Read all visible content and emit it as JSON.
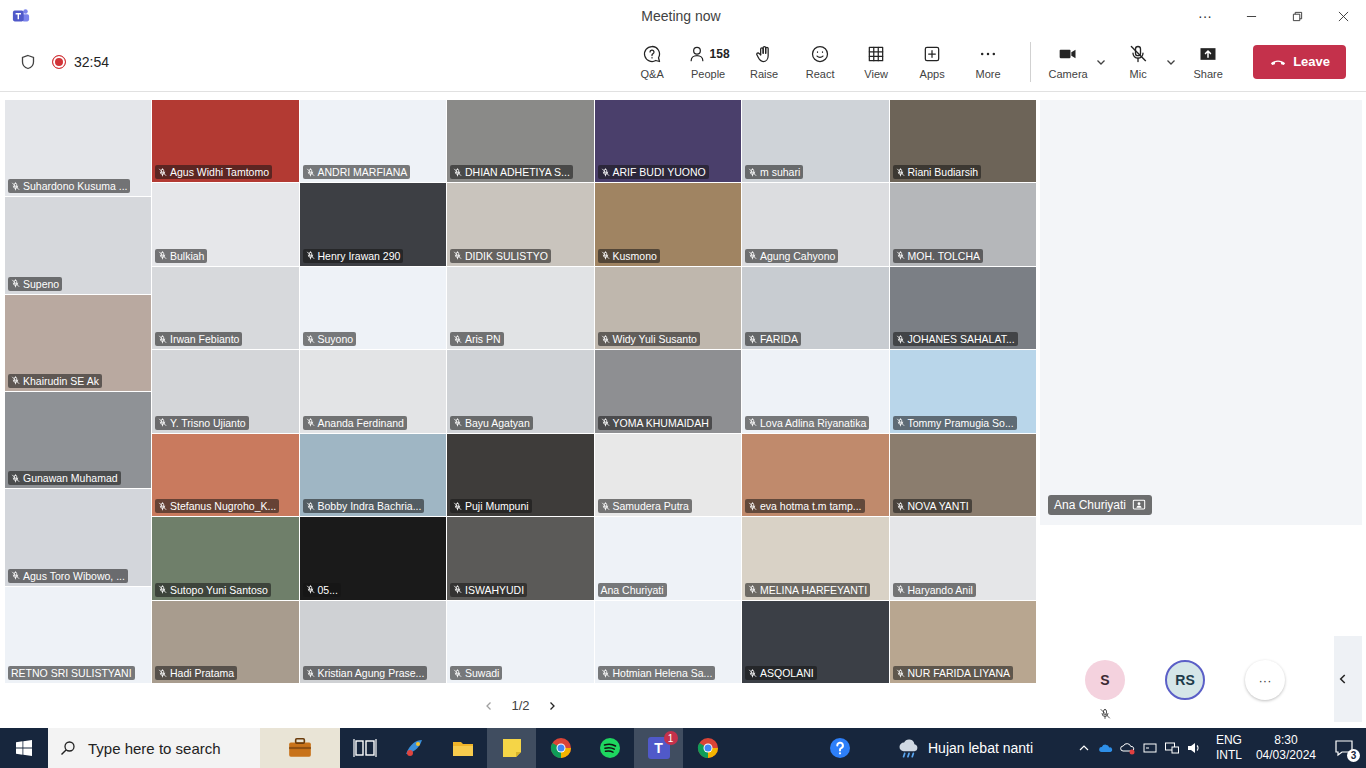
{
  "window": {
    "title": "Meeting now",
    "more": "···"
  },
  "toolbar": {
    "recording": true,
    "timer": "32:54",
    "tools": [
      {
        "label": "Q&A"
      },
      {
        "label": "People",
        "count": "158"
      },
      {
        "label": "Raise"
      },
      {
        "label": "React"
      },
      {
        "label": "View"
      },
      {
        "label": "Apps"
      },
      {
        "label": "More"
      }
    ],
    "devices": [
      {
        "label": "Camera",
        "off": false,
        "menu": true
      },
      {
        "label": "Mic",
        "off": true,
        "menu": true
      },
      {
        "label": "Share",
        "off": false,
        "menu": false
      }
    ],
    "leave": "Leave"
  },
  "gallery": {
    "left_column": [
      {
        "name": "Suhardono Kusuma ...",
        "muted": true,
        "color": "#e4e6ea"
      },
      {
        "name": "Supeno",
        "muted": true,
        "color": "#d6d8dc"
      },
      {
        "name": "Khairudin SE Ak",
        "muted": true,
        "color": "#b9a9a0"
      },
      {
        "name": "Gunawan Muhamad",
        "muted": true,
        "color": "#8f9296"
      },
      {
        "name": "Agus Toro Wibowo, ...",
        "muted": true,
        "color": "#d3d6db"
      },
      {
        "name": "RETNO SRI SULISTYANI",
        "muted": false,
        "color": "#eef2f7"
      }
    ],
    "tiles": [
      {
        "name": "Agus Widhi Tamtomo",
        "muted": true,
        "color": "#b33a33"
      },
      {
        "name": "ANDRI MARFIANA",
        "muted": true,
        "color": "#eef2f7"
      },
      {
        "name": "DHIAN ADHETIYA S...",
        "muted": true,
        "color": "#8a8a88"
      },
      {
        "name": "ARIF BUDI YUONO",
        "muted": true,
        "color": "#4a3f6b"
      },
      {
        "name": "m suhari",
        "muted": true,
        "color": "#cfd3d8"
      },
      {
        "name": "Riani Budiarsih",
        "muted": true,
        "color": "#6d6458"
      },
      {
        "name": "Bulkiah",
        "muted": true,
        "color": "#e6e7ea"
      },
      {
        "name": "Henry Irawan 290",
        "muted": true,
        "color": "#3d3f44"
      },
      {
        "name": "DIDIK SULISTYO",
        "muted": true,
        "color": "#c9c4bd"
      },
      {
        "name": "Kusmono",
        "muted": true,
        "color": "#a08462"
      },
      {
        "name": "Agung Cahyono",
        "muted": true,
        "color": "#dcdde0"
      },
      {
        "name": "MOH. TOLCHA",
        "muted": true,
        "color": "#b5b7ba"
      },
      {
        "name": "Irwan Febianto",
        "muted": true,
        "color": "#d7d9dc"
      },
      {
        "name": "Suyono",
        "muted": true,
        "color": "#eef2f7"
      },
      {
        "name": "Aris PN",
        "muted": true,
        "color": "#e1e3e5"
      },
      {
        "name": "Widy Yuli Susanto",
        "muted": true,
        "color": "#bfb7ad"
      },
      {
        "name": "FARIDA",
        "muted": true,
        "color": "#c8ccd1"
      },
      {
        "name": "JOHANES SAHALAT...",
        "muted": true,
        "color": "#7b7f85"
      },
      {
        "name": "Y. Trisno Ujianto",
        "muted": true,
        "color": "#d4d6d9"
      },
      {
        "name": "Ananda Ferdinand",
        "muted": true,
        "color": "#e3e4e6"
      },
      {
        "name": "Bayu Agatyan",
        "muted": true,
        "color": "#cfd2d6"
      },
      {
        "name": "YOMA KHUMAIDAH",
        "muted": true,
        "color": "#8e8f92"
      },
      {
        "name": "Lova Adlina Riyanatika",
        "muted": true,
        "color": "#eef2f7"
      },
      {
        "name": "Tommy Pramugia So...",
        "muted": true,
        "color": "#b9d6ea"
      },
      {
        "name": "Stefanus Nugroho_K...",
        "muted": true,
        "color": "#c97a5e"
      },
      {
        "name": "Bobby Indra Bachria...",
        "muted": true,
        "color": "#9fb6c4"
      },
      {
        "name": "Puji Mumpuni",
        "muted": true,
        "color": "#3e3c3a"
      },
      {
        "name": "Samudera Putra",
        "muted": true,
        "color": "#e8e8e8"
      },
      {
        "name": "eva hotma t.m tamp...",
        "muted": true,
        "color": "#c08a6c"
      },
      {
        "name": "NOVA YANTI",
        "muted": true,
        "color": "#8b7d6e"
      },
      {
        "name": "Sutopo Yuni Santoso",
        "muted": true,
        "color": "#6f7f6a"
      },
      {
        "name": "05...",
        "muted": true,
        "color": "#1a1a1a"
      },
      {
        "name": "ISWAHYUDI",
        "muted": true,
        "color": "#5b5a58"
      },
      {
        "name": "Ana Churiyati",
        "muted": false,
        "color": "#eef2f7"
      },
      {
        "name": "MELINA HARFEYANTI",
        "muted": true,
        "color": "#d9d2c6"
      },
      {
        "name": "Haryando Anil",
        "muted": true,
        "color": "#e5e6e8"
      },
      {
        "name": "Hadi Pratama",
        "muted": true,
        "color": "#a89c8e"
      },
      {
        "name": "Kristian Agung Prase...",
        "muted": true,
        "color": "#cfd1d4"
      },
      {
        "name": "Suwadi",
        "muted": true,
        "color": "#eef2f7"
      },
      {
        "name": "Hotmian Helena Sa...",
        "muted": true,
        "color": "#eef2f7"
      },
      {
        "name": "ASQOLANI",
        "muted": true,
        "color": "#3b3f46"
      },
      {
        "name": "NUR FARIDA LIYANA",
        "muted": true,
        "color": "#b8a690"
      }
    ],
    "page": "1/2"
  },
  "spotlight": {
    "name": "Ana Churiyati",
    "color": "#f3f5f8"
  },
  "overflow": {
    "participants": [
      {
        "initials": "S",
        "muted": true,
        "speaking": false,
        "color": "#f4d2de"
      },
      {
        "initials": "RS",
        "muted": false,
        "speaking": true,
        "color": "#d5e6e8"
      }
    ],
    "more": "···"
  },
  "taskbar": {
    "search_placeholder": "Type here to search",
    "apps": [
      {
        "kind": "taskview",
        "active": false
      },
      {
        "kind": "paint",
        "active": false
      },
      {
        "kind": "explorer",
        "active": false
      },
      {
        "kind": "notes",
        "active": true
      },
      {
        "kind": "chrome",
        "active": false
      },
      {
        "kind": "spotify",
        "active": false
      },
      {
        "kind": "teams",
        "active": true,
        "glyph": "T",
        "badge": "1"
      },
      {
        "kind": "chrome",
        "active": false
      }
    ],
    "weather": "Hujan lebat nanti",
    "language": [
      "ENG",
      "INTL"
    ],
    "time": "8:30",
    "date": "04/03/2024",
    "notifications": "3"
  }
}
